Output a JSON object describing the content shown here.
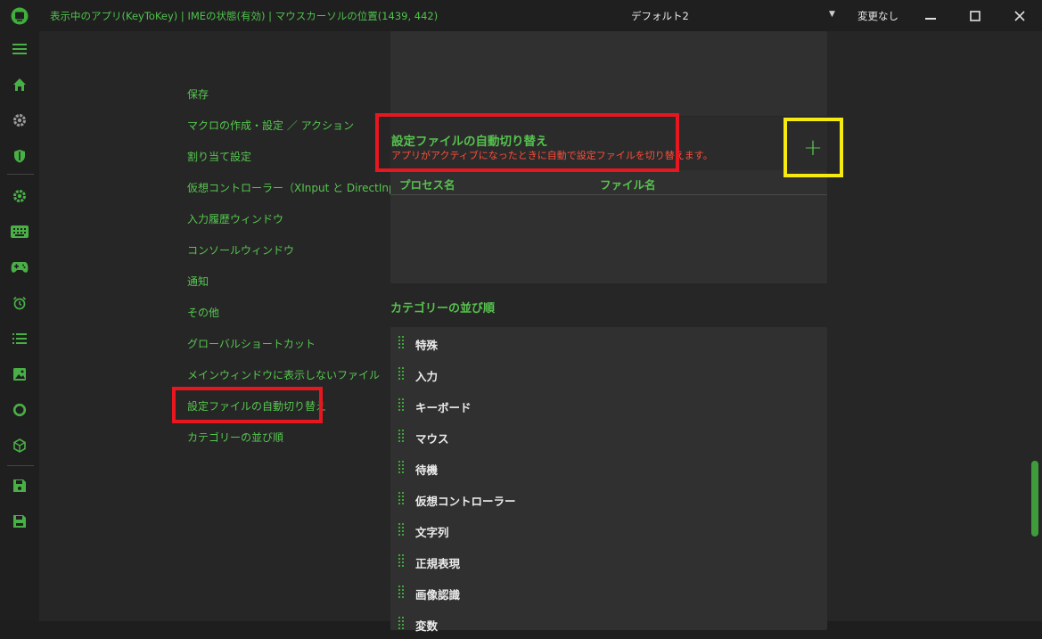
{
  "titlebar": {
    "status": "表示中のアプリ(KeyToKey)  |  IMEの状態(有効)  |  マウスカーソルの位置(1439, 442)",
    "profile": "デフォルト2",
    "change_state": "変更なし",
    "minimize_glyph": "—",
    "maximize_glyph": "☐",
    "close_glyph": "✕"
  },
  "nav": {
    "items": [
      "保存",
      "マクロの作成・設定 ／ アクション",
      "割り当て設定",
      "仮想コントローラー（XInput と DirectInput）",
      "入力履歴ウィンドウ",
      "コンソールウィンドウ",
      "通知",
      "その他",
      "グローバルショートカット",
      "メインウィンドウに表示しないファイル",
      "設定ファイルの自動切り替え",
      "カテゴリーの並び順"
    ]
  },
  "auto_switch": {
    "title": "設定ファイルの自動切り替え",
    "subtitle": "アプリがアクティブになったときに自動で設定ファイルを切り替えます。",
    "add_symbol": "+",
    "col_process": "プロセス名",
    "col_file": "ファイル名"
  },
  "category_order": {
    "title": "カテゴリーの並び順",
    "items": [
      "特殊",
      "入力",
      "キーボード",
      "マウス",
      "待機",
      "仮想コントローラー",
      "文字列",
      "正規表現",
      "画像認識",
      "変数"
    ]
  },
  "colors": {
    "accent_green": "#56c24e",
    "warning_red": "#ff4d3a",
    "highlight_red": "#e8161f",
    "highlight_yellow": "#f5ea12"
  },
  "icons": {
    "sidebar": [
      "menu-icon",
      "home-icon",
      "settings-icon",
      "shield-icon",
      "gear-icon",
      "keyboard-icon",
      "gamepad-icon",
      "alarm-icon",
      "list-icon",
      "image-icon",
      "circle-icon",
      "cube-icon",
      "save-icon",
      "save-as-icon"
    ]
  }
}
